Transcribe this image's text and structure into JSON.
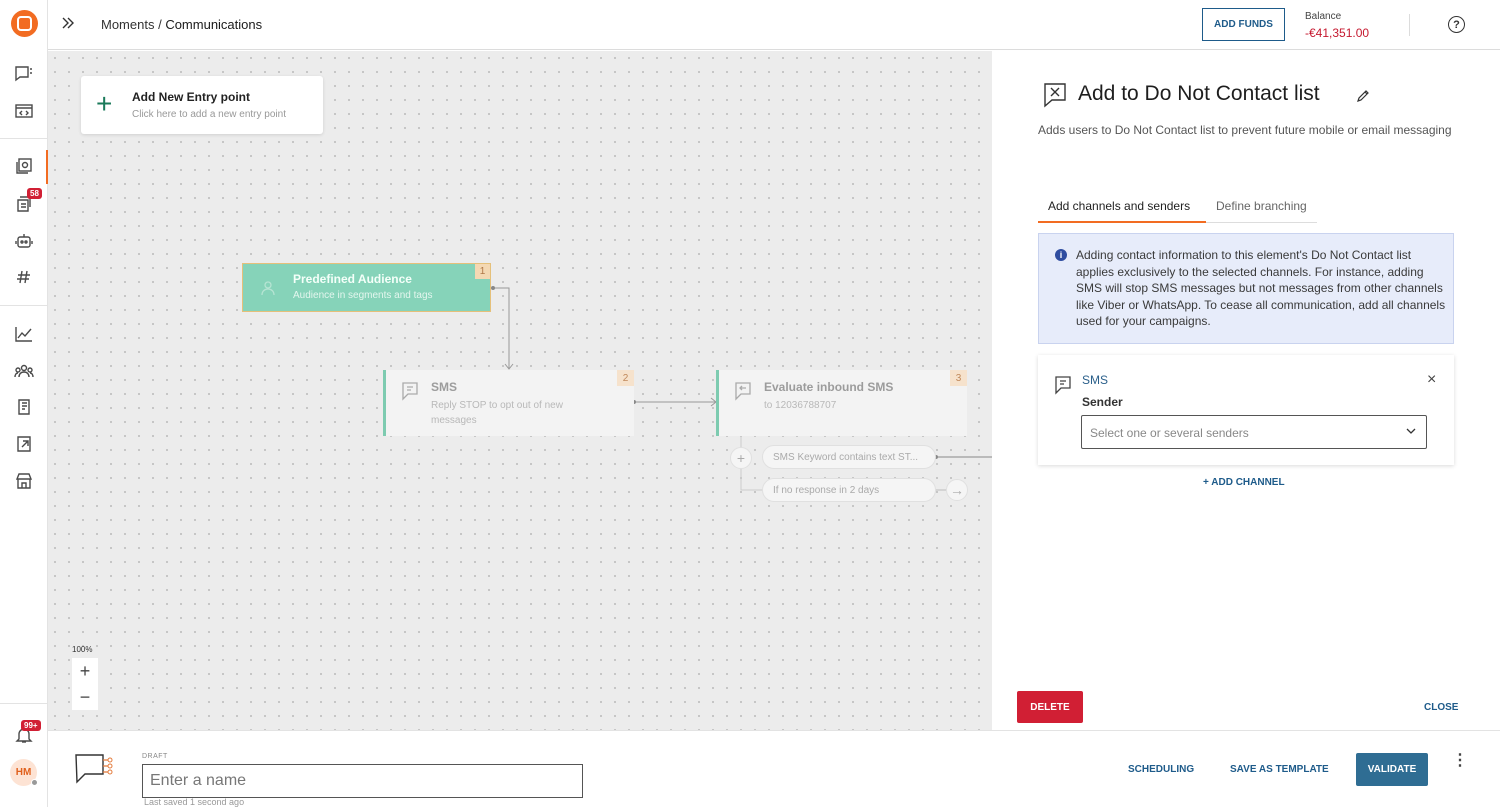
{
  "app": {
    "brand_color": "#f26c22"
  },
  "sidebar": {
    "items": [
      {
        "icon": "chat-icon"
      },
      {
        "icon": "code-window-icon"
      },
      {
        "icon": "moments-icon",
        "active": true
      },
      {
        "icon": "conversations-icon",
        "badge": "58"
      },
      {
        "icon": "bot-icon"
      },
      {
        "icon": "hashtag-icon"
      },
      {
        "icon": "analytics-icon"
      },
      {
        "icon": "people-icon"
      },
      {
        "icon": "docs-icon"
      },
      {
        "icon": "exports-icon"
      },
      {
        "icon": "store-icon"
      }
    ],
    "notifications_badge": "99+",
    "avatar_initials": "HM"
  },
  "header": {
    "breadcrumb_root": "Moments",
    "breadcrumb_sep": " / ",
    "breadcrumb_current": "Communications",
    "add_funds_label": "ADD FUNDS",
    "balance_label": "Balance",
    "balance_value": "-€41,351.00",
    "help_label": "?"
  },
  "canvas": {
    "entry_title": "Add New Entry point",
    "entry_subtitle": "Click here to add a new entry point",
    "audience": {
      "title": "Predefined Audience",
      "subtitle": "Audience in segments and tags",
      "num": "1"
    },
    "sms": {
      "title": "SMS",
      "subtitle": "Reply STOP to opt out of new messages",
      "num": "2"
    },
    "evaluate": {
      "title": "Evaluate inbound SMS",
      "subtitle": "to 12036788707",
      "num": "3"
    },
    "branch_1": "SMS Keyword contains text ST...",
    "branch_2": "If no response in 2 days",
    "zoom_level": "100%",
    "zoom_in": "+",
    "zoom_out": "−"
  },
  "panel": {
    "title": "Add to Do Not Contact list",
    "description": "Adds users to Do Not Contact list to prevent future mobile or email messaging",
    "tabs": [
      {
        "label": "Add channels and senders",
        "active": true
      },
      {
        "label": "Define branching",
        "active": false
      }
    ],
    "info_text": "Adding contact information to this element's Do Not Contact list applies exclusively to the selected channels. For instance, adding SMS will stop SMS messages but not messages from other channels like Viber or WhatsApp. To cease all communication, add all channels used for your campaigns.",
    "channel": {
      "name": "SMS",
      "sender_label": "Sender",
      "sender_placeholder": "Select one or several senders",
      "remove": "×"
    },
    "add_channel_label": "+ ADD CHANNEL",
    "delete_label": "DELETE",
    "close_label": "CLOSE"
  },
  "bottom": {
    "draft_label": "DRAFT",
    "name_placeholder": "Enter a name",
    "last_saved": "Last saved 1 second ago",
    "scheduling_label": "SCHEDULING",
    "save_template_label": "SAVE AS TEMPLATE",
    "validate_label": "VALIDATE",
    "more": "⋮"
  }
}
